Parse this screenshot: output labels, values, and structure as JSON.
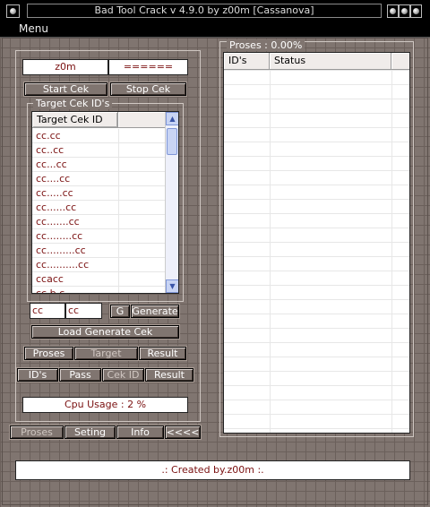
{
  "window": {
    "title": "Bad Tool Crack v 4.9.0 by z00m [Cassanova]",
    "system_icon": "orb-icon",
    "controls": [
      "minimize-button",
      "maximize-button",
      "close-button"
    ]
  },
  "menu": {
    "menu_label": "Menu"
  },
  "left": {
    "field_user": "z0m",
    "field_pass": "======",
    "start_label": "Start Cek",
    "stop_label": "Stop Cek",
    "target_group_label": "Target Cek ID's",
    "list_header": "Target Cek ID",
    "list_items": [
      "cc.cc",
      "cc..cc",
      "cc...cc",
      "cc....cc",
      "cc.....cc",
      "cc......cc",
      "cc.......cc",
      "cc........cc",
      "cc.........cc",
      "cc..........cc",
      "ccacc",
      "cc.b.c"
    ],
    "gen_field_1": "cc",
    "gen_field_2": "cc",
    "g_label": "G",
    "generate_label": "Generate",
    "load_label": "Load Generate Cek",
    "tabs_row1": [
      "Proses",
      "Target",
      "Result"
    ],
    "tabs_row2": [
      "ID's",
      "Pass",
      "Cek ID",
      "Result"
    ],
    "cpu_usage": "Cpu Usage : 2 %"
  },
  "bottom_tabs": [
    "Proses",
    "Seting",
    "Info",
    "<<<<"
  ],
  "right": {
    "proses_label": "Proses : 0.00%",
    "col_ids": "ID's",
    "col_status": "Status"
  },
  "footer": {
    "credit": ".: Created by.z00m :."
  }
}
